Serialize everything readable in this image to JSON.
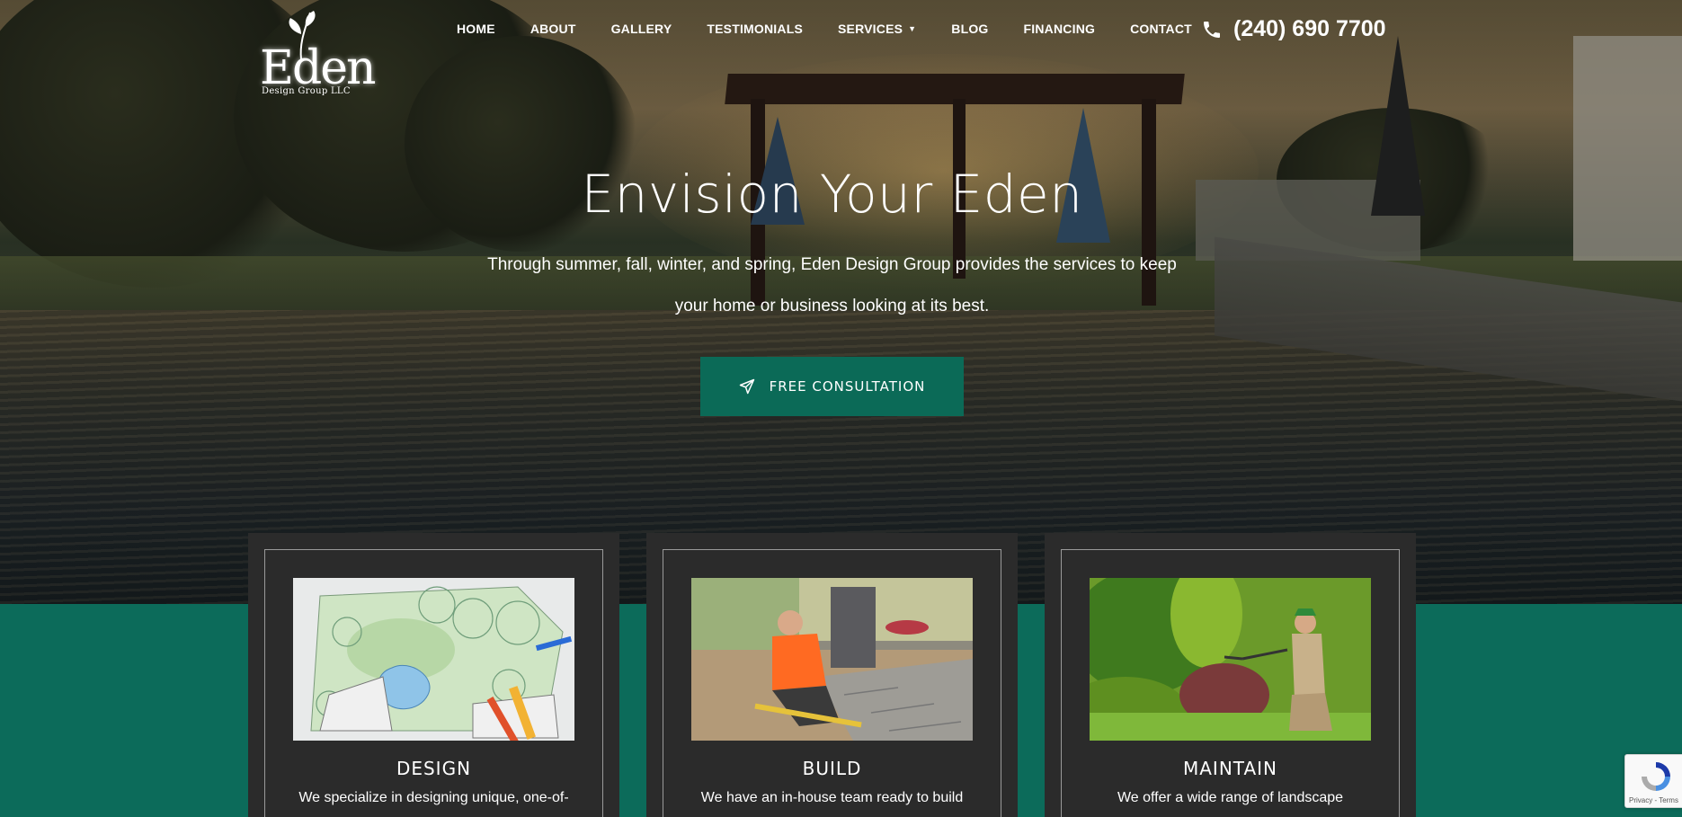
{
  "brand": {
    "name": "Eden",
    "tagline": "Design Group LLC"
  },
  "nav": {
    "items": [
      {
        "label": "HOME"
      },
      {
        "label": "ABOUT"
      },
      {
        "label": "GALLERY"
      },
      {
        "label": "TESTIMONIALS"
      },
      {
        "label": "SERVICES",
        "has_dropdown": true
      },
      {
        "label": "BLOG"
      },
      {
        "label": "FINANCING"
      },
      {
        "label": "CONTACT"
      }
    ],
    "phone": "(240) 690 7700"
  },
  "hero": {
    "title": "Envision Your Eden",
    "subtitle": "Through summer, fall, winter, and spring, Eden Design Group provides the services to keep your home or business looking at its best.",
    "cta_label": "FREE CONSULTATION"
  },
  "services": [
    {
      "title": "DESIGN",
      "text": "We specialize in designing unique, one-of-",
      "image": "landscape-plan-drawing"
    },
    {
      "title": "BUILD",
      "text": "We have an in-house team ready to build",
      "image": "worker-laying-pavers"
    },
    {
      "title": "MAINTAIN",
      "text": "We offer a wide range of landscape",
      "image": "gardener-trimming-hedge"
    }
  ],
  "recaptcha": {
    "label": "Privacy - Terms"
  },
  "colors": {
    "brand_green": "#0b6a57",
    "card_bg": "#2b2b2b",
    "text": "#ffffff"
  }
}
